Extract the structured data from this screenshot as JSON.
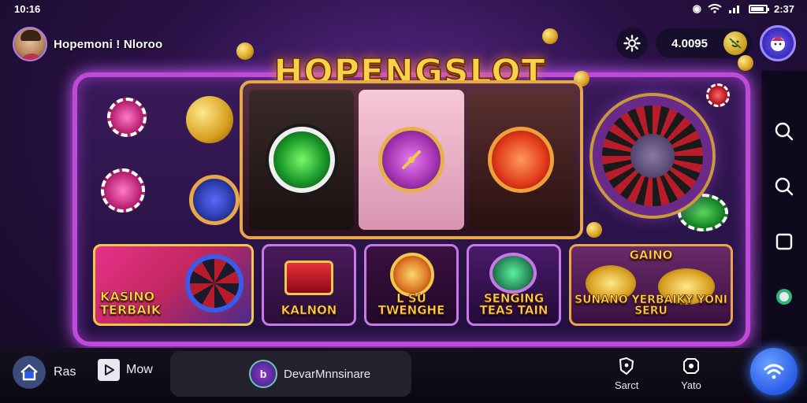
{
  "status_bar": {
    "time": "10:16",
    "clock": "2:37"
  },
  "profile": {
    "name": "Hopemoni ! Nloroo"
  },
  "top_right": {
    "balance": "4.0095"
  },
  "logo": {
    "text": "HOPENGSLOT"
  },
  "tiles": [
    {
      "label": "KASINO TERBAIK"
    },
    {
      "label": "KALNON"
    },
    {
      "label": "L SU TWENGHE"
    },
    {
      "label": "SENGING TEAS TAIN"
    },
    {
      "title": "GAINO",
      "label": "SUNANO YERBAIKY  YONI SERU"
    }
  ],
  "bottom_nav": {
    "home_label": "Ras",
    "mow_label": "Mow",
    "center_label": "DevarMnnsinare",
    "center_logo": "b",
    "item1_label": "Sarct",
    "item2_label": "Yato"
  },
  "colors": {
    "accent": "#c04ad8",
    "gold": "#f9d24a",
    "fab": "#2a5ae8"
  },
  "icons": [
    "gear-icon",
    "emoji-coin-icon",
    "profile-icon",
    "search-icon",
    "search-icon",
    "square-icon",
    "circle-icon",
    "home-icon",
    "play-icon",
    "app-logo-icon",
    "sparkle-icon",
    "tag-icon",
    "wifi-icon"
  ]
}
